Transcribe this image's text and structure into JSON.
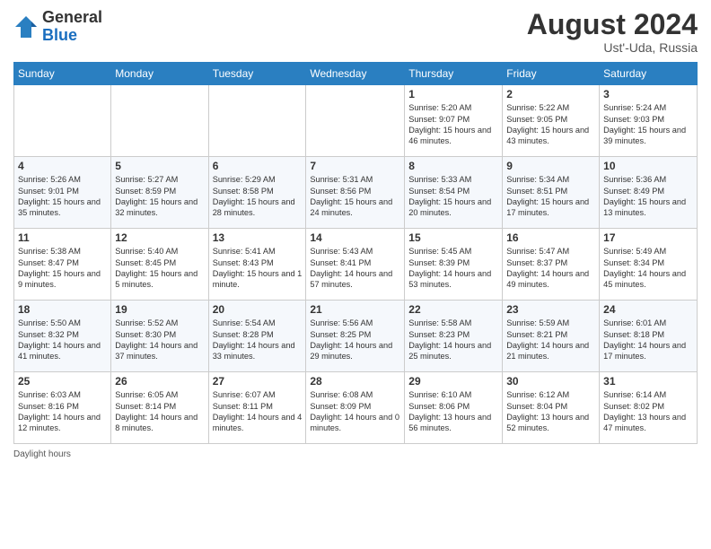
{
  "header": {
    "logo_general": "General",
    "logo_blue": "Blue",
    "month_title": "August 2024",
    "subtitle": "Ust'-Uda, Russia"
  },
  "days_of_week": [
    "Sunday",
    "Monday",
    "Tuesday",
    "Wednesday",
    "Thursday",
    "Friday",
    "Saturday"
  ],
  "footer": {
    "daylight_label": "Daylight hours"
  },
  "weeks": [
    [
      {
        "num": "",
        "info": ""
      },
      {
        "num": "",
        "info": ""
      },
      {
        "num": "",
        "info": ""
      },
      {
        "num": "",
        "info": ""
      },
      {
        "num": "1",
        "info": "Sunrise: 5:20 AM\nSunset: 9:07 PM\nDaylight: 15 hours\nand 46 minutes."
      },
      {
        "num": "2",
        "info": "Sunrise: 5:22 AM\nSunset: 9:05 PM\nDaylight: 15 hours\nand 43 minutes."
      },
      {
        "num": "3",
        "info": "Sunrise: 5:24 AM\nSunset: 9:03 PM\nDaylight: 15 hours\nand 39 minutes."
      }
    ],
    [
      {
        "num": "4",
        "info": "Sunrise: 5:26 AM\nSunset: 9:01 PM\nDaylight: 15 hours\nand 35 minutes."
      },
      {
        "num": "5",
        "info": "Sunrise: 5:27 AM\nSunset: 8:59 PM\nDaylight: 15 hours\nand 32 minutes."
      },
      {
        "num": "6",
        "info": "Sunrise: 5:29 AM\nSunset: 8:58 PM\nDaylight: 15 hours\nand 28 minutes."
      },
      {
        "num": "7",
        "info": "Sunrise: 5:31 AM\nSunset: 8:56 PM\nDaylight: 15 hours\nand 24 minutes."
      },
      {
        "num": "8",
        "info": "Sunrise: 5:33 AM\nSunset: 8:54 PM\nDaylight: 15 hours\nand 20 minutes."
      },
      {
        "num": "9",
        "info": "Sunrise: 5:34 AM\nSunset: 8:51 PM\nDaylight: 15 hours\nand 17 minutes."
      },
      {
        "num": "10",
        "info": "Sunrise: 5:36 AM\nSunset: 8:49 PM\nDaylight: 15 hours\nand 13 minutes."
      }
    ],
    [
      {
        "num": "11",
        "info": "Sunrise: 5:38 AM\nSunset: 8:47 PM\nDaylight: 15 hours\nand 9 minutes."
      },
      {
        "num": "12",
        "info": "Sunrise: 5:40 AM\nSunset: 8:45 PM\nDaylight: 15 hours\nand 5 minutes."
      },
      {
        "num": "13",
        "info": "Sunrise: 5:41 AM\nSunset: 8:43 PM\nDaylight: 15 hours\nand 1 minute."
      },
      {
        "num": "14",
        "info": "Sunrise: 5:43 AM\nSunset: 8:41 PM\nDaylight: 14 hours\nand 57 minutes."
      },
      {
        "num": "15",
        "info": "Sunrise: 5:45 AM\nSunset: 8:39 PM\nDaylight: 14 hours\nand 53 minutes."
      },
      {
        "num": "16",
        "info": "Sunrise: 5:47 AM\nSunset: 8:37 PM\nDaylight: 14 hours\nand 49 minutes."
      },
      {
        "num": "17",
        "info": "Sunrise: 5:49 AM\nSunset: 8:34 PM\nDaylight: 14 hours\nand 45 minutes."
      }
    ],
    [
      {
        "num": "18",
        "info": "Sunrise: 5:50 AM\nSunset: 8:32 PM\nDaylight: 14 hours\nand 41 minutes."
      },
      {
        "num": "19",
        "info": "Sunrise: 5:52 AM\nSunset: 8:30 PM\nDaylight: 14 hours\nand 37 minutes."
      },
      {
        "num": "20",
        "info": "Sunrise: 5:54 AM\nSunset: 8:28 PM\nDaylight: 14 hours\nand 33 minutes."
      },
      {
        "num": "21",
        "info": "Sunrise: 5:56 AM\nSunset: 8:25 PM\nDaylight: 14 hours\nand 29 minutes."
      },
      {
        "num": "22",
        "info": "Sunrise: 5:58 AM\nSunset: 8:23 PM\nDaylight: 14 hours\nand 25 minutes."
      },
      {
        "num": "23",
        "info": "Sunrise: 5:59 AM\nSunset: 8:21 PM\nDaylight: 14 hours\nand 21 minutes."
      },
      {
        "num": "24",
        "info": "Sunrise: 6:01 AM\nSunset: 8:18 PM\nDaylight: 14 hours\nand 17 minutes."
      }
    ],
    [
      {
        "num": "25",
        "info": "Sunrise: 6:03 AM\nSunset: 8:16 PM\nDaylight: 14 hours\nand 12 minutes."
      },
      {
        "num": "26",
        "info": "Sunrise: 6:05 AM\nSunset: 8:14 PM\nDaylight: 14 hours\nand 8 minutes."
      },
      {
        "num": "27",
        "info": "Sunrise: 6:07 AM\nSunset: 8:11 PM\nDaylight: 14 hours\nand 4 minutes."
      },
      {
        "num": "28",
        "info": "Sunrise: 6:08 AM\nSunset: 8:09 PM\nDaylight: 14 hours\nand 0 minutes."
      },
      {
        "num": "29",
        "info": "Sunrise: 6:10 AM\nSunset: 8:06 PM\nDaylight: 13 hours\nand 56 minutes."
      },
      {
        "num": "30",
        "info": "Sunrise: 6:12 AM\nSunset: 8:04 PM\nDaylight: 13 hours\nand 52 minutes."
      },
      {
        "num": "31",
        "info": "Sunrise: 6:14 AM\nSunset: 8:02 PM\nDaylight: 13 hours\nand 47 minutes."
      }
    ]
  ]
}
